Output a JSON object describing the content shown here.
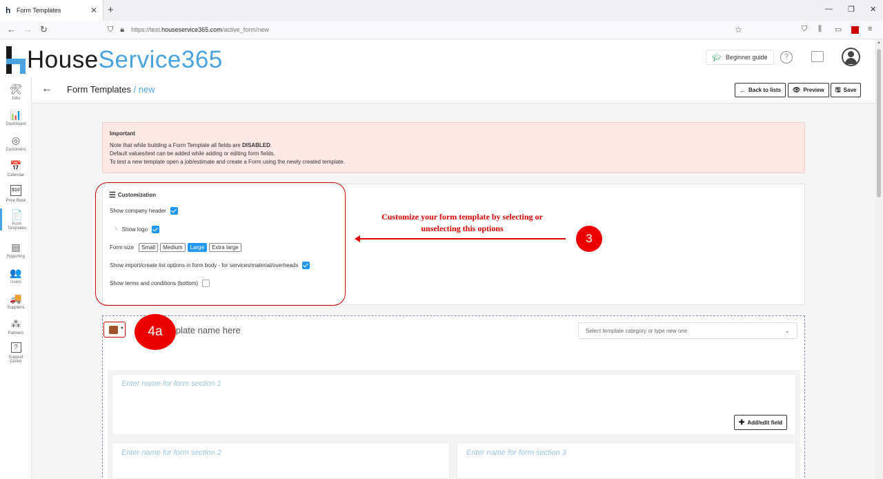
{
  "browser": {
    "tab_title": "Form Templates",
    "tab_close": "✕",
    "new_tab": "+",
    "url_prefix": "https://test.",
    "url_domain": "houseservice365.com",
    "url_path": "/active_form/new",
    "win_min": "—",
    "win_restore": "❐",
    "win_close": "✕"
  },
  "app": {
    "logo_part1": "House",
    "logo_part2": "Service365",
    "beginner_guide": "Beginner guide",
    "help": "?"
  },
  "sidebar": {
    "items": [
      {
        "label": "Jobs",
        "icon": "🛠"
      },
      {
        "label": "Dashboard",
        "icon": "📊"
      },
      {
        "label": "Customers",
        "icon": "◎"
      },
      {
        "label": "Calendar",
        "icon": "📅"
      },
      {
        "label": "Price Book",
        "icon": "$10"
      },
      {
        "label": "Form",
        "label2": "Templates",
        "icon": "📄"
      },
      {
        "label": "Reporting",
        "icon": "▤"
      },
      {
        "label": "Users",
        "icon": "👥"
      },
      {
        "label": "Suppliers",
        "icon": "🚚"
      },
      {
        "label": "Partners",
        "icon": "⁂"
      },
      {
        "label": "Support",
        "label2": "Center",
        "icon": "?"
      }
    ]
  },
  "page": {
    "back_arrow": "←",
    "title": "Form Templates",
    "subtitle": " / new",
    "back_to_lists": "Back to lists",
    "preview": "Preview",
    "save": "Save"
  },
  "important": {
    "heading": "Important",
    "line1_pre": "Note that while building a Form Template all fields are ",
    "line1_bold": "DISABLED",
    "line1_post": ".",
    "line2": "Default values/text can be added while adding or editing form fields.",
    "line3": "To test a new template open a job/estimate and create a Form using the newly created template."
  },
  "customization": {
    "heading": "Customization",
    "show_company_header": "Show company header",
    "show_logo": "Show logo",
    "form_size": "Form size",
    "sizes": [
      "Small",
      "Medium",
      "Large",
      "Extra large"
    ],
    "selected_size": "Large",
    "show_import": "Show import/create list options in form body - for services/material/overheads",
    "show_terms": "Show terms and conditions (bottom)"
  },
  "annotation": {
    "line1": "Customize your form template by selecting or",
    "line2": "unselecting this options",
    "badge3": "3",
    "badge4a": "4a"
  },
  "template": {
    "name_placeholder": "mplate name here",
    "category_placeholder": "Select template category or type new one",
    "section1": "Enter name for form section 1",
    "section2": "Enter name for form section 2",
    "section3": "Enter name for form section 3",
    "add_edit_field": "Add/edit field"
  },
  "colors": {
    "accent": "#4aa3df",
    "checkbox": "#2196f3",
    "swatch": "#a0522d",
    "annotation": "#dd0000"
  }
}
